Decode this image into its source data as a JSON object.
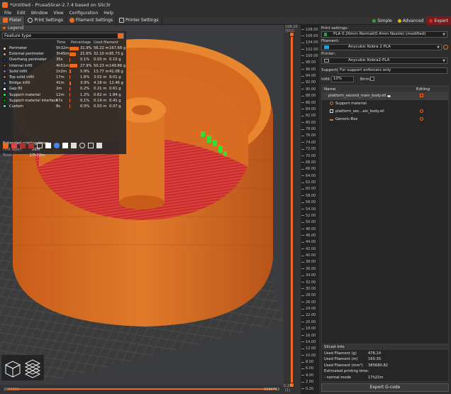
{
  "window": {
    "title": "*Untitled - PrusaSlicer-2.7.4 based on Slic3r"
  },
  "menu": [
    "File",
    "Edit",
    "Window",
    "View",
    "Configuration",
    "Help"
  ],
  "tabs": [
    {
      "label": "Plater",
      "icon": "cube-icon",
      "active": true
    },
    {
      "label": "Print Settings",
      "icon": "gear-icon",
      "active": false
    },
    {
      "label": "Filament Settings",
      "icon": "spool-icon",
      "active": false
    },
    {
      "label": "Printer Settings",
      "icon": "printer-icon",
      "active": false
    }
  ],
  "modes": [
    {
      "label": "Simple",
      "color": "#2ea043"
    },
    {
      "label": "Advanced",
      "color": "#e6b800"
    },
    {
      "label": "Expert",
      "color": "#d12b2b"
    }
  ],
  "legend": {
    "title": "Legend",
    "feature_type": "Feature type",
    "columns": [
      "Time",
      "Percentage",
      "Used filament"
    ],
    "rows": [
      {
        "name": "Perimeter",
        "color": "#ffe600",
        "time": "5h32m",
        "pct": "31.9%",
        "length": "56.22 m",
        "weight": "167.68 g",
        "frac": 0.319
      },
      {
        "name": "External perimeter",
        "color": "#ff7d38",
        "time": "3h45m",
        "pct": "21.6%",
        "length": "32.10 m",
        "weight": "95.73 g",
        "frac": 0.216
      },
      {
        "name": "Overhang perimeter",
        "color": "#1f1fff",
        "time": "35s",
        "pct": "0.1%",
        "length": "0.03 m",
        "weight": "0.10 g",
        "frac": 0.001
      },
      {
        "name": "Internal infill",
        "color": "#b03029",
        "time": "4h51m",
        "pct": "27.9%",
        "length": "50.23 m",
        "weight": "149.86 g",
        "frac": 0.279
      },
      {
        "name": "Solid infill",
        "color": "#9654cc",
        "time": "1h2m",
        "pct": "5.9%",
        "length": "13.77 m",
        "weight": "41.08 g",
        "frac": 0.059
      },
      {
        "name": "Top solid infill",
        "color": "#f04040",
        "time": "17m",
        "pct": "1.6%",
        "length": "3.02 m",
        "weight": "9.01 g",
        "frac": 0.016
      },
      {
        "name": "Bridge infill",
        "color": "#4d80ba",
        "time": "41m",
        "pct": "3.9%",
        "length": "4.18 m",
        "weight": "12.46 g",
        "frac": 0.039
      },
      {
        "name": "Gap fill",
        "color": "#ffffff",
        "time": "2m",
        "pct": "0.2%",
        "length": "0.21 m",
        "weight": "0.61 g",
        "frac": 0.002
      },
      {
        "name": "Support material",
        "color": "#00ff00",
        "time": "12m",
        "pct": "1.2%",
        "length": "0.62 m",
        "weight": "1.84 g",
        "frac": 0.012
      },
      {
        "name": "Support material interface",
        "color": "#008000",
        "time": "57s",
        "pct": "0.1%",
        "length": "0.14 m",
        "weight": "0.41 g",
        "frac": 0.001
      },
      {
        "name": "Custom",
        "color": "#5ed194",
        "time": "8s",
        "pct": "0.0%",
        "length": "0.03 m",
        "weight": "0.07 g",
        "frac": 0.0
      }
    ],
    "estimated_title": "Estimated printing times",
    "first_layer_label": "First layer:",
    "first_layer": "20m",
    "total_label": "Total:",
    "total": "17h22m"
  },
  "vslider": {
    "top": "108.20",
    "top_layer": "(551)",
    "bottom": "0.20",
    "bottom_layer": "(1)"
  },
  "ruler": [
    "108.00",
    "106.00",
    "104.00",
    "102.00",
    "100.00",
    "98.00",
    "96.00",
    "94.00",
    "92.00",
    "90.00",
    "88.00",
    "86.00",
    "84.00",
    "82.00",
    "80.00",
    "78.00",
    "76.00",
    "74.00",
    "72.00",
    "70.00",
    "68.00",
    "66.00",
    "64.00",
    "62.00",
    "60.00",
    "58.00",
    "56.00",
    "54.00",
    "52.00",
    "50.00",
    "48.00",
    "46.00",
    "44.00",
    "42.00",
    "40.00",
    "38.00",
    "36.00",
    "34.00",
    "32.00",
    "30.00",
    "28.00",
    "26.00",
    "24.00",
    "22.00",
    "20.00",
    "18.00",
    "16.00",
    "14.00",
    "12.00",
    "10.00",
    "8.00",
    "6.00",
    "4.00",
    "2.00",
    "0.20"
  ],
  "hslider": {
    "left": "2059352",
    "right": "2066783"
  },
  "panel": {
    "print_settings_label": "Print settings:",
    "print_settings_value": "PLA 0.20mm Normal(0.4mm Nozzle) (modified)",
    "filament_label": "Filament:",
    "filament_value": "Anycubic Kobra 2 PLA",
    "filament_color": "#1fa0e0",
    "printer_label": "Printer:",
    "printer_value": "Anycubic Kobra2-PLA",
    "supports_label": "Supports:",
    "supports_value": "For support enforcers only",
    "infill_label": "Infill:",
    "infill_value": "10%",
    "brim_label": "Brim:"
  },
  "objects": {
    "col_name": "Name",
    "col_editing": "Editing",
    "rows": [
      {
        "name": "platform_second_main_body.stl",
        "indent": 0
      },
      {
        "name": "Support material",
        "indent": 1
      },
      {
        "name": "platform_sec...ain_body.stl",
        "indent": 1
      },
      {
        "name": "Generic-Box",
        "indent": 1
      }
    ]
  },
  "sliced": {
    "title": "Sliced Info",
    "rows": [
      {
        "label": "Used Filament (g)",
        "value": "478.24"
      },
      {
        "label": "Used Filament (m)",
        "value": "160.35"
      },
      {
        "label": "Used Filament (mm³)",
        "value": "385680.82"
      },
      {
        "label": "Estimated printing time:",
        "value": ""
      },
      {
        "label": " - normal mode",
        "value": "17h22m"
      }
    ]
  },
  "export_label": "Export G-code"
}
